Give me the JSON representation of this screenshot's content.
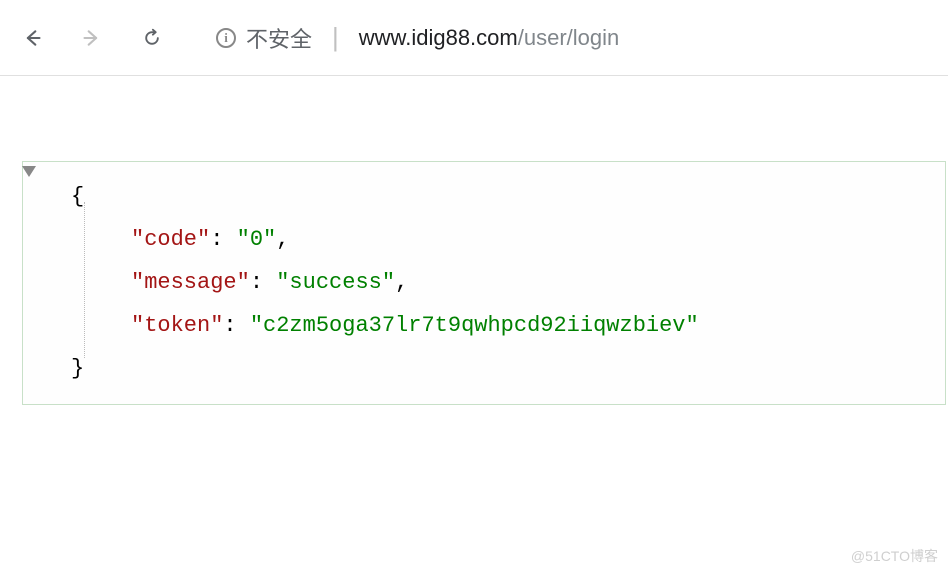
{
  "browser": {
    "security_label": "不安全",
    "url_host": "www.idig88.com",
    "url_path": "/user/login"
  },
  "json_response": {
    "keys": {
      "code": "\"code\"",
      "message": "\"message\"",
      "token": "\"token\""
    },
    "values": {
      "code": "\"0\"",
      "message": "\"success\"",
      "token": "\"c2zm5oga37lr7t9qwhpcd92iiqwzbiev\""
    },
    "brace_open": "{",
    "brace_close": "}",
    "colon": ":",
    "comma": ","
  },
  "watermark": "@51CTO博客"
}
